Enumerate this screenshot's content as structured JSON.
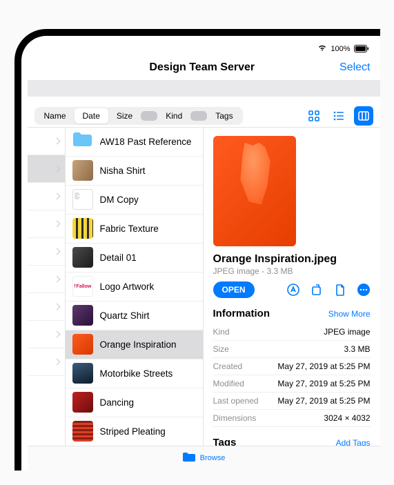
{
  "status": {
    "battery": "100%"
  },
  "header": {
    "title": "Design Team Server",
    "select": "Select"
  },
  "sort": {
    "options": [
      "Name",
      "Date",
      "Size",
      "Kind",
      "Tags"
    ],
    "active": "Date"
  },
  "col1_rows": 9,
  "col1_selected_index": 1,
  "files": [
    {
      "name": "AW18 Past Reference",
      "thumb": "folder"
    },
    {
      "name": "Nisha Shirt",
      "thumb": "linear-gradient(120deg,#c7a37c,#8e6a48)"
    },
    {
      "name": "DM Copy",
      "thumb": "doc"
    },
    {
      "name": "Fabric Texture",
      "thumb": "repeating-linear-gradient(90deg,#f4d63a 0 5px,#2b2b2b 5px 8px)"
    },
    {
      "name": "Detail 01",
      "thumb": "linear-gradient(135deg,#4a4a4a,#1c1c1c)"
    },
    {
      "name": "Logo Artwork",
      "thumb": "logo"
    },
    {
      "name": "Quartz Shirt",
      "thumb": "linear-gradient(135deg,#5a3a6a,#2c0f3c)"
    },
    {
      "name": "Orange Inspiration",
      "thumb": "linear-gradient(135deg,#ff5a1f,#d63a00)",
      "selected": true
    },
    {
      "name": "Motorbike Streets",
      "thumb": "linear-gradient(160deg,#3b5b7a,#0e1d2c)"
    },
    {
      "name": "Dancing",
      "thumb": "linear-gradient(135deg,#c02020,#6e0d0d)"
    },
    {
      "name": "Striped Pleating",
      "thumb": "repeating-linear-gradient(0deg,#d8402a 0 3px,#8f1d10 3px 6px)"
    }
  ],
  "detail": {
    "filename": "Orange Inspiration.jpeg",
    "subtitle": "JPEG image - 3.3 MB",
    "open": "OPEN",
    "info_title": "Information",
    "show_more": "Show More",
    "info": [
      {
        "k": "Kind",
        "v": "JPEG image"
      },
      {
        "k": "Size",
        "v": "3.3 MB"
      },
      {
        "k": "Created",
        "v": "May 27, 2019 at 5:25 PM"
      },
      {
        "k": "Modified",
        "v": "May 27, 2019 at 5:25 PM"
      },
      {
        "k": "Last opened",
        "v": "May 27, 2019 at 5:25 PM"
      },
      {
        "k": "Dimensions",
        "v": "3024 × 4032"
      }
    ],
    "tags_title": "Tags",
    "add_tags": "Add Tags"
  },
  "bottom": {
    "browse": "Browse"
  }
}
